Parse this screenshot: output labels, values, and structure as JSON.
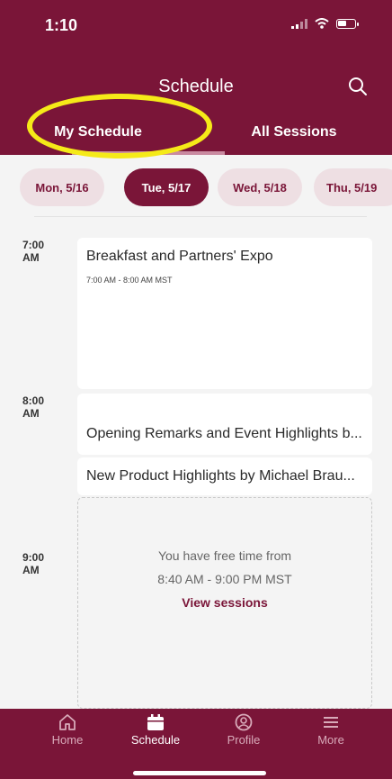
{
  "status_bar": {
    "time": "1:10"
  },
  "header": {
    "title": "Schedule",
    "tabs": [
      {
        "label": "My Schedule",
        "active": true
      },
      {
        "label": "All Sessions",
        "active": false
      }
    ]
  },
  "days": [
    {
      "label": "Mon, 5/16",
      "selected": false
    },
    {
      "label": "Tue, 5/17",
      "selected": true
    },
    {
      "label": "Wed, 5/18",
      "selected": false
    },
    {
      "label": "Thu, 5/19",
      "selected": false
    }
  ],
  "timeline": {
    "times": [
      {
        "hour": "7:00",
        "period": "AM"
      },
      {
        "hour": "8:00",
        "period": "AM"
      },
      {
        "hour": "9:00",
        "period": "AM"
      }
    ]
  },
  "sessions": [
    {
      "title": "Breakfast and Partners' Expo",
      "time": "7:00 AM - 8:00 AM MST"
    },
    {
      "title": "Opening Remarks and Event Highlights b..."
    },
    {
      "title": "New Product Highlights by Michael Brau..."
    }
  ],
  "free_time": {
    "line1": "You have free time from",
    "line2": "8:40 AM - 9:00 PM MST",
    "link": "View sessions"
  },
  "tabbar": {
    "items": [
      {
        "label": "Home",
        "icon": "home-icon"
      },
      {
        "label": "Schedule",
        "icon": "calendar-icon",
        "active": true
      },
      {
        "label": "Profile",
        "icon": "profile-icon"
      },
      {
        "label": "More",
        "icon": "menu-icon"
      }
    ]
  },
  "colors": {
    "brand": "#7a1538",
    "chip": "#eedfe3",
    "highlight": "#f5ea18"
  }
}
